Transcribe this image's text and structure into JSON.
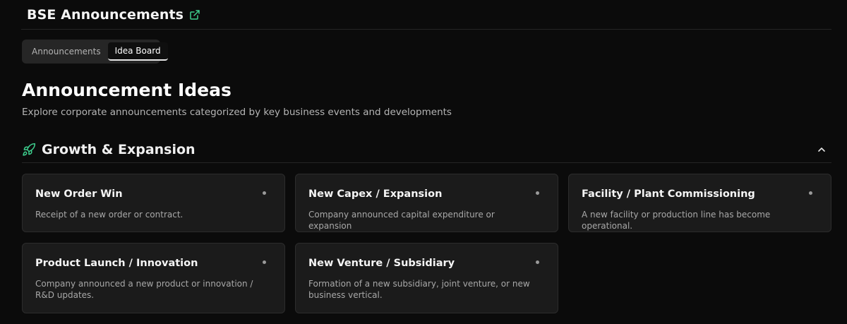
{
  "header": {
    "app_title": "BSE Announcements",
    "accent_color": "#3ecf8e"
  },
  "tabs": [
    {
      "label": "Announcements",
      "active": false
    },
    {
      "label": "Idea Board",
      "active": true
    }
  ],
  "page": {
    "title": "Announcement Ideas",
    "subtitle": "Explore corporate announcements categorized by key business events and developments"
  },
  "section": {
    "title": "Growth & Expansion",
    "icon": "rocket-icon",
    "expanded": true,
    "cards": [
      {
        "title": "New Order Win",
        "description": "Receipt of a new order or contract."
      },
      {
        "title": "New Capex / Expansion",
        "description": "Company announced capital expenditure or expansion"
      },
      {
        "title": "Facility / Plant Commissioning",
        "description": "A new facility or production line has become operational."
      },
      {
        "title": "Product Launch / Innovation",
        "description": "Company announced a new product or innovation / R&D updates."
      },
      {
        "title": "New Venture / Subsidiary",
        "description": "Formation of a new subsidiary, joint venture, or new business vertical."
      }
    ]
  }
}
